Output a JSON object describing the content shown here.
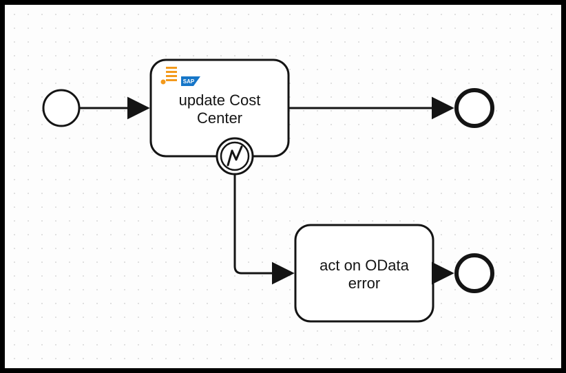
{
  "diagram": {
    "task1": {
      "label_line1": "update Cost",
      "label_line2": "Center"
    },
    "task2": {
      "label_line1": "act on OData",
      "label_line2": "error"
    },
    "sap_badge": "SAP"
  }
}
